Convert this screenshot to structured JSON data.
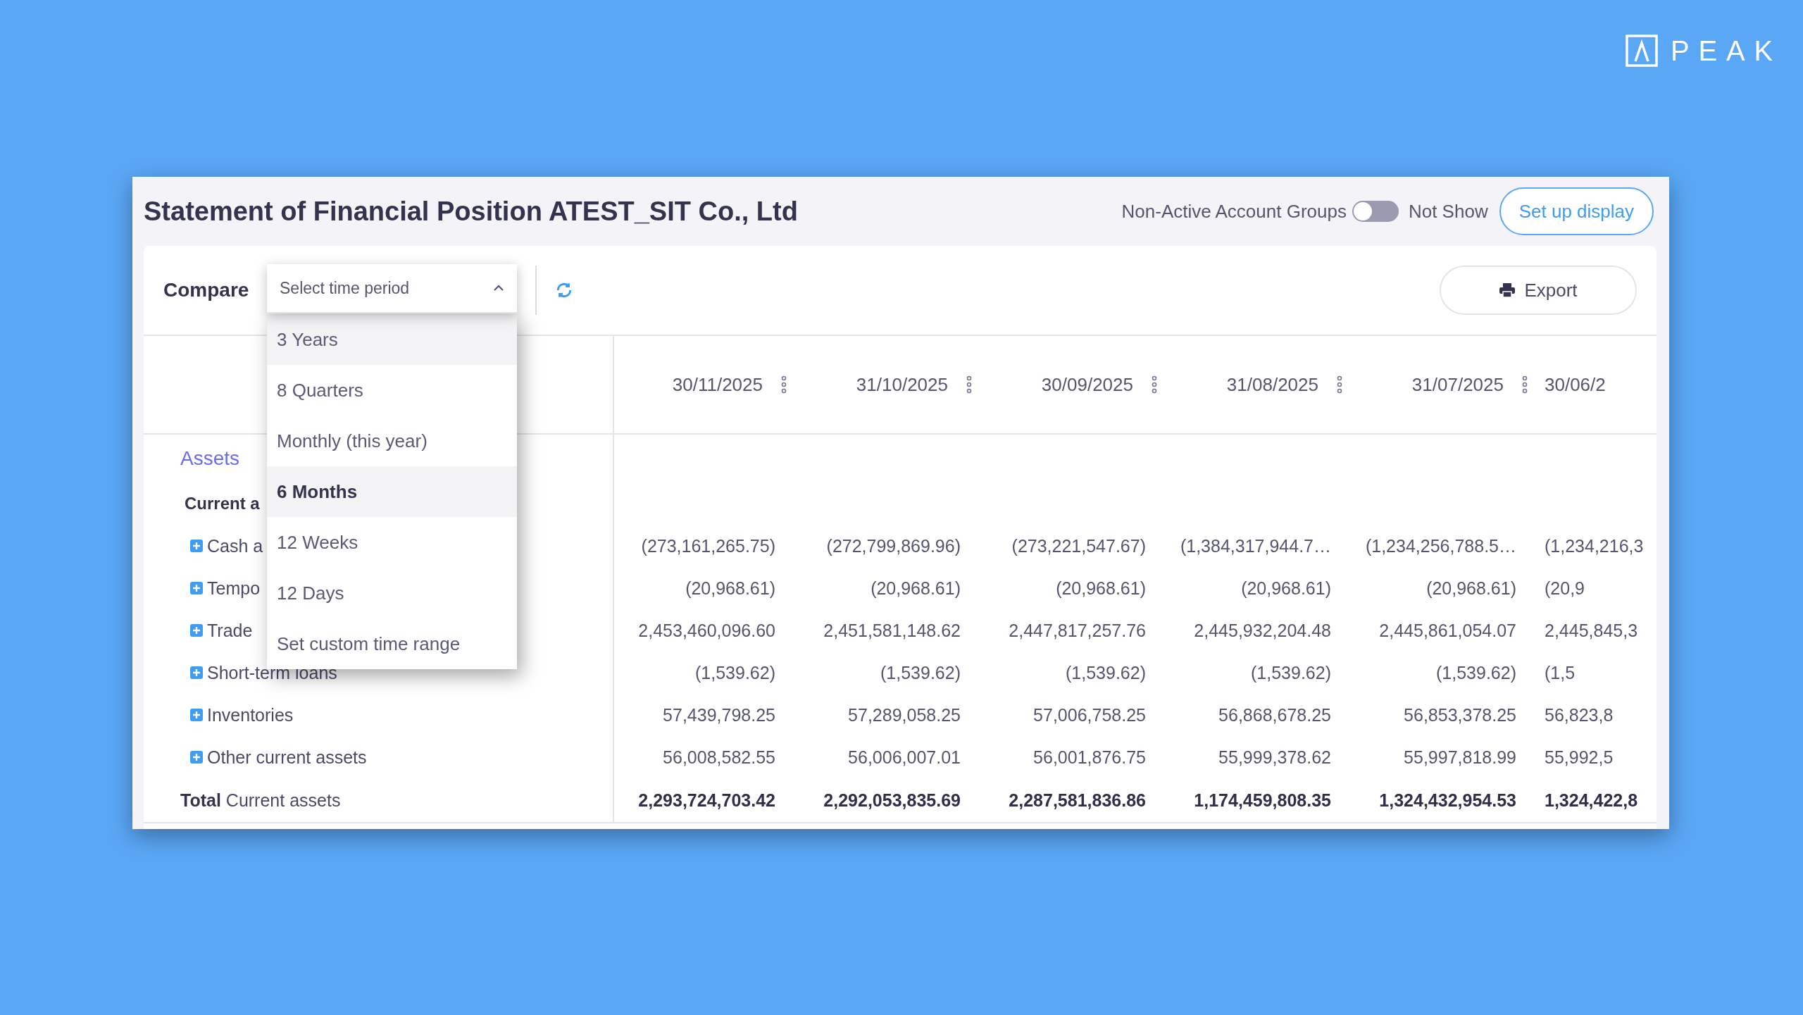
{
  "logo": {
    "text": "PEAK"
  },
  "header": {
    "title": "Statement of Financial Position ATEST_SIT Co., Ltd",
    "toggle_label": "Non-Active Account Groups",
    "toggle": {
      "on": false
    },
    "toggle_state_label": "Not Show",
    "setup_button": "Set up display"
  },
  "toolbar": {
    "compare_label": "Compare",
    "select": {
      "placeholder": "Select time period",
      "expanded": true
    },
    "export_button": "Export"
  },
  "dropdown": [
    {
      "label": "3 Years",
      "selected": false,
      "hovered": true
    },
    {
      "label": "8 Quarters",
      "selected": false,
      "hovered": false
    },
    {
      "label": "Monthly (this year)",
      "selected": false,
      "hovered": false
    },
    {
      "label": "6 Months",
      "selected": true,
      "hovered": false
    },
    {
      "label": "12 Weeks",
      "selected": false,
      "hovered": false
    },
    {
      "label": "12 Days",
      "selected": false,
      "hovered": false
    },
    {
      "label": "Set custom time range",
      "selected": false,
      "hovered": false
    }
  ],
  "table": {
    "columns": [
      "30/11/2025",
      "31/10/2025",
      "30/09/2025",
      "31/08/2025",
      "31/07/2025",
      "30/06/2"
    ],
    "rows": [
      {
        "kind": "section",
        "label": "Assets"
      },
      {
        "kind": "group",
        "label": "Current a"
      },
      {
        "kind": "account",
        "label": "Cash a",
        "values": [
          "(273,161,265.75)",
          "(272,799,869.96)",
          "(273,221,547.67)",
          "(1,384,317,944.7…",
          "(1,234,256,788.5…",
          "(1,234,216,3"
        ]
      },
      {
        "kind": "account",
        "label": "Tempo",
        "values": [
          "(20,968.61)",
          "(20,968.61)",
          "(20,968.61)",
          "(20,968.61)",
          "(20,968.61)",
          "(20,9"
        ]
      },
      {
        "kind": "account",
        "label": "Trade",
        "values": [
          "2,453,460,096.60",
          "2,451,581,148.62",
          "2,447,817,257.76",
          "2,445,932,204.48",
          "2,445,861,054.07",
          "2,445,845,3"
        ]
      },
      {
        "kind": "account",
        "label": "Short-term loans",
        "values": [
          "(1,539.62)",
          "(1,539.62)",
          "(1,539.62)",
          "(1,539.62)",
          "(1,539.62)",
          "(1,5"
        ]
      },
      {
        "kind": "account",
        "label": "Inventories",
        "values": [
          "57,439,798.25",
          "57,289,058.25",
          "57,006,758.25",
          "56,868,678.25",
          "56,853,378.25",
          "56,823,8"
        ]
      },
      {
        "kind": "account",
        "label": "Other current assets",
        "values": [
          "56,008,582.55",
          "56,006,007.01",
          "56,001,876.75",
          "55,999,378.62",
          "55,997,818.99",
          "55,992,5"
        ]
      },
      {
        "kind": "total",
        "label": "**Total** Current assets",
        "values": [
          "2,293,724,703.42",
          "2,292,053,835.69",
          "2,287,581,836.86",
          "1,174,459,808.35",
          "1,324,432,954.53",
          "1,324,422,8"
        ]
      }
    ]
  }
}
